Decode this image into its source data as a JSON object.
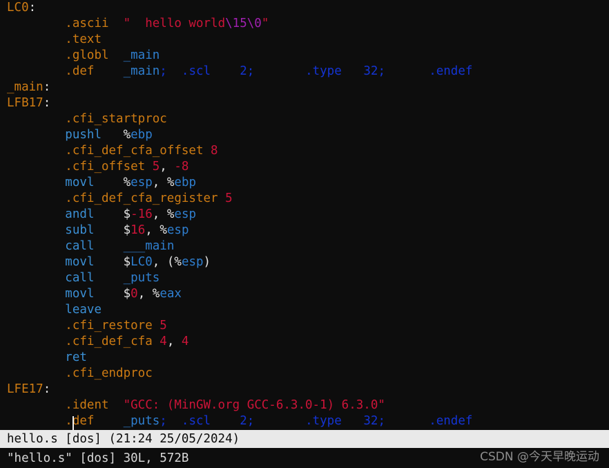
{
  "editor": {
    "app": "vim",
    "background": "#0d0d0d",
    "colors": {
      "label": "#cd7b13",
      "directive": "#cd7b13",
      "instruction": "#3b8fd4",
      "identifier": "#2f7fd0",
      "number": "#cc1438",
      "string": "#cc1438",
      "escape": "#a020b0",
      "deep_blue": "#1434d4",
      "punctuation": "#e6e6e6",
      "statusbar_bg": "#e9e9e9",
      "statusbar_fg": "#0a0a0a"
    }
  },
  "buffer": {
    "lines": [
      {
        "indent": false,
        "tokens": [
          {
            "t": "LC0",
            "c": "label"
          },
          {
            "t": ":",
            "c": "punct"
          }
        ]
      },
      {
        "indent": true,
        "tokens": [
          {
            "t": ".ascii",
            "c": "directive"
          },
          {
            "t": "  ",
            "c": "ws"
          },
          {
            "t": "\"",
            "c": "str"
          },
          {
            "t": "  ",
            "c": "ws"
          },
          {
            "t": "hello world",
            "c": "str"
          },
          {
            "t": "\\15",
            "c": "esc"
          },
          {
            "t": "\\0",
            "c": "esc"
          },
          {
            "t": "\"",
            "c": "str"
          }
        ]
      },
      {
        "indent": true,
        "tokens": [
          {
            "t": ".text",
            "c": "directive"
          }
        ]
      },
      {
        "indent": true,
        "tokens": [
          {
            "t": ".globl",
            "c": "directive"
          },
          {
            "t": "  ",
            "c": "ws"
          },
          {
            "t": "_main",
            "c": "ident"
          }
        ]
      },
      {
        "indent": true,
        "tokens": [
          {
            "t": ".def",
            "c": "directive"
          },
          {
            "t": "    ",
            "c": "ws"
          },
          {
            "t": "_main",
            "c": "ident"
          },
          {
            "t": ";",
            "c": "blue"
          },
          {
            "t": "  ",
            "c": "ws"
          },
          {
            "t": ".scl",
            "c": "blue"
          },
          {
            "t": "    ",
            "c": "ws"
          },
          {
            "t": "2;",
            "c": "blue"
          },
          {
            "t": "       ",
            "c": "ws"
          },
          {
            "t": ".type",
            "c": "blue"
          },
          {
            "t": "   ",
            "c": "ws"
          },
          {
            "t": "32;",
            "c": "blue"
          },
          {
            "t": "      ",
            "c": "ws"
          },
          {
            "t": ".endef",
            "c": "blue"
          }
        ]
      },
      {
        "indent": false,
        "tokens": [
          {
            "t": "_main",
            "c": "label"
          },
          {
            "t": ":",
            "c": "punct"
          }
        ]
      },
      {
        "indent": false,
        "tokens": [
          {
            "t": "LFB17",
            "c": "label"
          },
          {
            "t": ":",
            "c": "punct"
          }
        ]
      },
      {
        "indent": true,
        "tokens": [
          {
            "t": ".cfi_startproc",
            "c": "directive"
          }
        ]
      },
      {
        "indent": true,
        "tokens": [
          {
            "t": "pushl",
            "c": "instr"
          },
          {
            "t": "   ",
            "c": "ws"
          },
          {
            "t": "%",
            "c": "sigil"
          },
          {
            "t": "ebp",
            "c": "reg"
          }
        ]
      },
      {
        "indent": true,
        "tokens": [
          {
            "t": ".cfi_def_cfa_offset",
            "c": "directive"
          },
          {
            "t": " ",
            "c": "ws"
          },
          {
            "t": "8",
            "c": "num"
          }
        ]
      },
      {
        "indent": true,
        "tokens": [
          {
            "t": ".cfi_offset",
            "c": "directive"
          },
          {
            "t": " ",
            "c": "ws"
          },
          {
            "t": "5",
            "c": "num"
          },
          {
            "t": ",",
            "c": "punct"
          },
          {
            "t": " ",
            "c": "ws"
          },
          {
            "t": "-8",
            "c": "num"
          }
        ]
      },
      {
        "indent": true,
        "tokens": [
          {
            "t": "movl",
            "c": "instr"
          },
          {
            "t": "    ",
            "c": "ws"
          },
          {
            "t": "%",
            "c": "sigil"
          },
          {
            "t": "esp",
            "c": "reg"
          },
          {
            "t": ",",
            "c": "punct"
          },
          {
            "t": " ",
            "c": "ws"
          },
          {
            "t": "%",
            "c": "sigil"
          },
          {
            "t": "ebp",
            "c": "reg"
          }
        ]
      },
      {
        "indent": true,
        "tokens": [
          {
            "t": ".cfi_def_cfa_register",
            "c": "directive"
          },
          {
            "t": " ",
            "c": "ws"
          },
          {
            "t": "5",
            "c": "num"
          }
        ]
      },
      {
        "indent": true,
        "tokens": [
          {
            "t": "andl",
            "c": "instr"
          },
          {
            "t": "    ",
            "c": "ws"
          },
          {
            "t": "$",
            "c": "sigil"
          },
          {
            "t": "-16",
            "c": "num"
          },
          {
            "t": ",",
            "c": "punct"
          },
          {
            "t": " ",
            "c": "ws"
          },
          {
            "t": "%",
            "c": "sigil"
          },
          {
            "t": "esp",
            "c": "reg"
          }
        ]
      },
      {
        "indent": true,
        "tokens": [
          {
            "t": "subl",
            "c": "instr"
          },
          {
            "t": "    ",
            "c": "ws"
          },
          {
            "t": "$",
            "c": "sigil"
          },
          {
            "t": "16",
            "c": "num"
          },
          {
            "t": ",",
            "c": "punct"
          },
          {
            "t": " ",
            "c": "ws"
          },
          {
            "t": "%",
            "c": "sigil"
          },
          {
            "t": "esp",
            "c": "reg"
          }
        ]
      },
      {
        "indent": true,
        "tokens": [
          {
            "t": "call",
            "c": "instr"
          },
          {
            "t": "    ",
            "c": "ws"
          },
          {
            "t": "___main",
            "c": "ident"
          }
        ]
      },
      {
        "indent": true,
        "tokens": [
          {
            "t": "movl",
            "c": "instr"
          },
          {
            "t": "    ",
            "c": "ws"
          },
          {
            "t": "$",
            "c": "sigil"
          },
          {
            "t": "LC0",
            "c": "ident"
          },
          {
            "t": ",",
            "c": "punct"
          },
          {
            "t": " (",
            "c": "punct"
          },
          {
            "t": "%",
            "c": "sigil"
          },
          {
            "t": "esp",
            "c": "reg"
          },
          {
            "t": ")",
            "c": "punct"
          }
        ]
      },
      {
        "indent": true,
        "tokens": [
          {
            "t": "call",
            "c": "instr"
          },
          {
            "t": "    ",
            "c": "ws"
          },
          {
            "t": "_puts",
            "c": "ident"
          }
        ]
      },
      {
        "indent": true,
        "tokens": [
          {
            "t": "movl",
            "c": "instr"
          },
          {
            "t": "    ",
            "c": "ws"
          },
          {
            "t": "$",
            "c": "sigil"
          },
          {
            "t": "0",
            "c": "num"
          },
          {
            "t": ",",
            "c": "punct"
          },
          {
            "t": " ",
            "c": "ws"
          },
          {
            "t": "%",
            "c": "sigil"
          },
          {
            "t": "eax",
            "c": "reg"
          }
        ]
      },
      {
        "indent": true,
        "tokens": [
          {
            "t": "leave",
            "c": "instr"
          }
        ]
      },
      {
        "indent": true,
        "tokens": [
          {
            "t": ".cfi_restore",
            "c": "directive"
          },
          {
            "t": " ",
            "c": "ws"
          },
          {
            "t": "5",
            "c": "num"
          }
        ]
      },
      {
        "indent": true,
        "tokens": [
          {
            "t": ".cfi_def_cfa",
            "c": "directive"
          },
          {
            "t": " ",
            "c": "ws"
          },
          {
            "t": "4",
            "c": "num"
          },
          {
            "t": ",",
            "c": "punct"
          },
          {
            "t": " ",
            "c": "ws"
          },
          {
            "t": "4",
            "c": "num"
          }
        ]
      },
      {
        "indent": true,
        "tokens": [
          {
            "t": "ret",
            "c": "instr"
          }
        ]
      },
      {
        "indent": true,
        "tokens": [
          {
            "t": ".cfi_endproc",
            "c": "directive"
          }
        ]
      },
      {
        "indent": false,
        "tokens": [
          {
            "t": "LFE17",
            "c": "label"
          },
          {
            "t": ":",
            "c": "punct"
          }
        ]
      },
      {
        "indent": true,
        "tokens": [
          {
            "t": ".ident",
            "c": "directive"
          },
          {
            "t": "  ",
            "c": "ws"
          },
          {
            "t": "\"GCC: (MinGW.org GCC-6.3.0-1) 6.3.0\"",
            "c": "str"
          }
        ]
      },
      {
        "indent": true,
        "tokens": [
          {
            "t": ".def",
            "c": "directive"
          },
          {
            "t": "    ",
            "c": "ws"
          },
          {
            "t": "_puts",
            "c": "ident"
          },
          {
            "t": ";",
            "c": "blue"
          },
          {
            "t": "  ",
            "c": "ws"
          },
          {
            "t": ".scl",
            "c": "blue"
          },
          {
            "t": "    ",
            "c": "ws"
          },
          {
            "t": "2;",
            "c": "blue"
          },
          {
            "t": "       ",
            "c": "ws"
          },
          {
            "t": ".type",
            "c": "blue"
          },
          {
            "t": "   ",
            "c": "ws"
          },
          {
            "t": "32;",
            "c": "blue"
          },
          {
            "t": "      ",
            "c": "ws"
          },
          {
            "t": ".endef",
            "c": "blue"
          }
        ]
      }
    ]
  },
  "status_bar": {
    "text": "hello.s [dos] (21:24 25/05/2024)",
    "filename": "hello.s",
    "fileformat": "[dos]",
    "timestamp": "(21:24 25/05/2024)"
  },
  "message_line": {
    "text": "\"hello.s\" [dos] 30L, 572B",
    "filename": "\"hello.s\"",
    "fileformat": "[dos]",
    "lines": "30L",
    "bytes": "572B"
  },
  "watermark": {
    "text": "CSDN @今天早晚运动"
  }
}
